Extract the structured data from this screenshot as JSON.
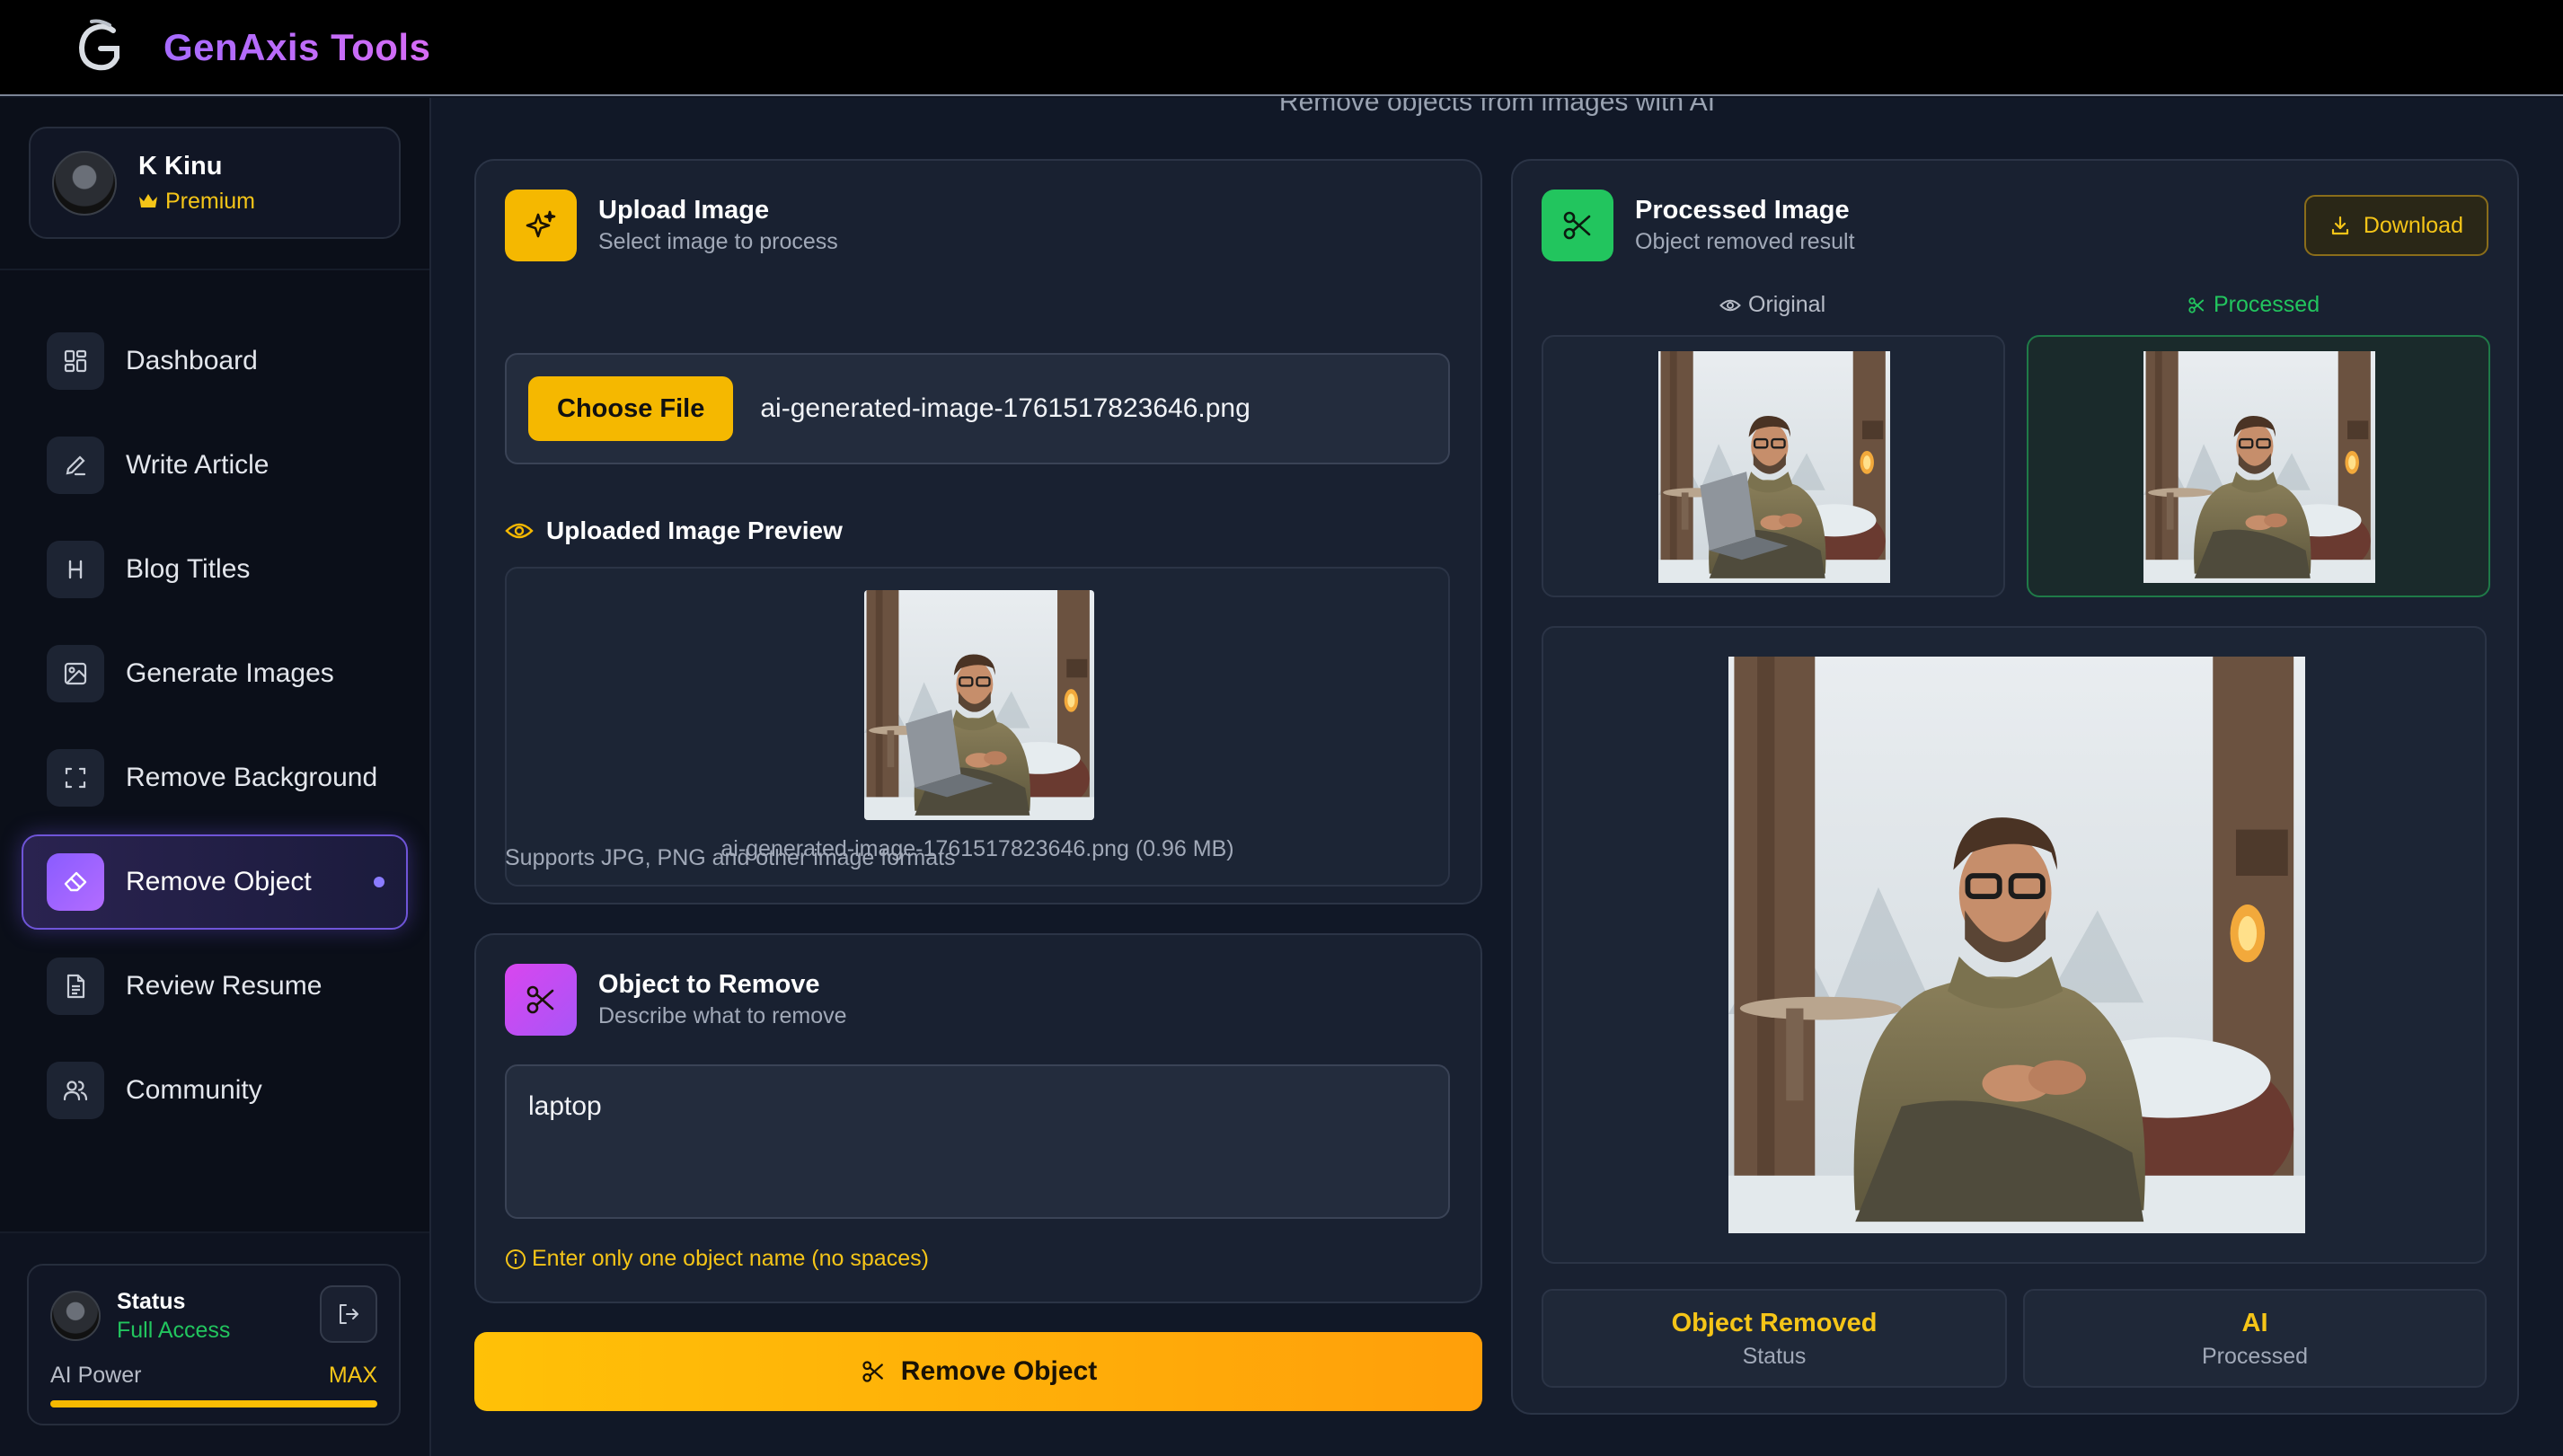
{
  "app": {
    "name": "GenAxis Tools"
  },
  "user": {
    "name": "K Kinu",
    "plan": "Premium"
  },
  "sidebar": {
    "items": [
      {
        "label": "Dashboard",
        "icon": "dashboard-icon"
      },
      {
        "label": "Write Article",
        "icon": "pen-icon"
      },
      {
        "label": "Blog Titles",
        "icon": "hash-icon"
      },
      {
        "label": "Generate Images",
        "icon": "image-icon"
      },
      {
        "label": "Remove Background",
        "icon": "crop-frame-icon"
      },
      {
        "label": "Remove Object",
        "icon": "eraser-icon",
        "active": true
      },
      {
        "label": "Review Resume",
        "icon": "document-icon"
      },
      {
        "label": "Community",
        "icon": "users-icon"
      }
    ],
    "status": {
      "title": "Status",
      "value": "Full Access",
      "power_label": "AI Power",
      "power_value": "MAX",
      "power_fill": 1.0
    }
  },
  "main": {
    "subtitle": "Remove objects from images with AI",
    "upload": {
      "title": "Upload Image",
      "subtitle": "Select image to process",
      "choose_label": "Choose File",
      "file_name": "ai-generated-image-1761517823646.png",
      "preview_label": "Uploaded Image Preview",
      "preview_caption": "ai-generated-image-1761517823646.png (0.96 MB)",
      "supports": "Supports JPG, PNG and other image formats"
    },
    "object": {
      "title": "Object to Remove",
      "subtitle": "Describe what to remove",
      "value": "laptop",
      "hint": "Enter only one object name (no spaces)"
    },
    "remove_button": "Remove Object",
    "processed": {
      "title": "Processed Image",
      "subtitle": "Object removed result",
      "download_label": "Download",
      "original_label": "Original",
      "processed_label": "Processed",
      "stats": [
        {
          "value": "Object Removed",
          "label": "Status"
        },
        {
          "value": "AI",
          "label": "Processed"
        }
      ]
    }
  },
  "colors": {
    "accent": "#f5b800",
    "purple": "#8a5cff",
    "success": "#22c55e",
    "pink": "#d946ef"
  }
}
